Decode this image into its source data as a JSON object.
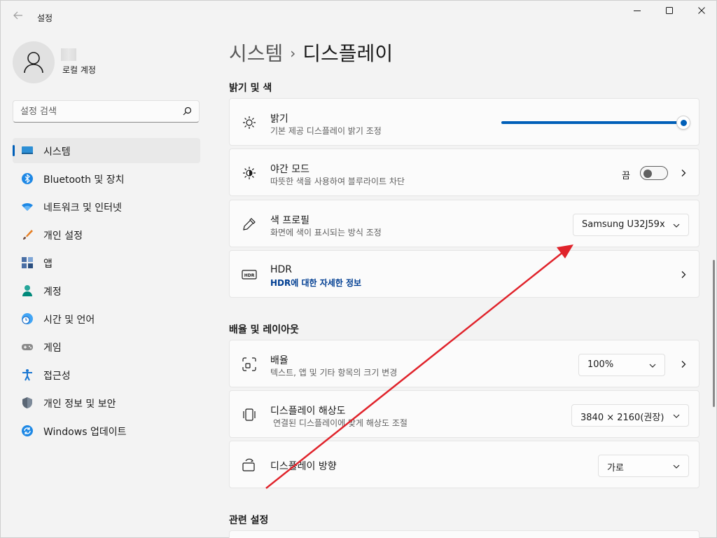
{
  "window": {
    "title": "설정",
    "back_icon": "back-arrow-icon"
  },
  "profile": {
    "account_type": "로컬 계정"
  },
  "search": {
    "placeholder": "설정 검색"
  },
  "nav": [
    {
      "label": "시스템",
      "icon": "monitor-icon",
      "active": true
    },
    {
      "label": "Bluetooth 및 장치",
      "icon": "bluetooth-icon"
    },
    {
      "label": "네트워크 및 인터넷",
      "icon": "wifi-icon"
    },
    {
      "label": "개인 설정",
      "icon": "brush-icon"
    },
    {
      "label": "앱",
      "icon": "apps-icon"
    },
    {
      "label": "계정",
      "icon": "person-icon"
    },
    {
      "label": "시간 및 언어",
      "icon": "clock-globe-icon"
    },
    {
      "label": "게임",
      "icon": "gamepad-icon"
    },
    {
      "label": "접근성",
      "icon": "accessibility-icon"
    },
    {
      "label": "개인 정보 및 보안",
      "icon": "shield-icon"
    },
    {
      "label": "Windows 업데이트",
      "icon": "update-icon"
    }
  ],
  "breadcrumb": {
    "parent": "시스템",
    "separator": "›",
    "current": "디스플레이"
  },
  "sections": {
    "brightness_color": "밝기 및 색",
    "scale_layout": "배율 및 레이아웃",
    "related": "관련 설정"
  },
  "brightness": {
    "title": "밝기",
    "subtitle": "기본 제공 디스플레이 밝기 조정",
    "value_fraction": 1.0
  },
  "night_light": {
    "title": "야간 모드",
    "subtitle": "따뜻한 색을 사용하여 블루라이트 차단",
    "state": "끔"
  },
  "color_profile": {
    "title": "색 프로필",
    "subtitle": "화면에 색이 표시되는 방식 조정",
    "value": "Samsung U32J59x"
  },
  "hdr": {
    "title": "HDR",
    "link": "HDR에 대한 자세한 정보"
  },
  "scale": {
    "title": "배율",
    "subtitle": "텍스트, 앱 및 기타 항목의 크기 변경",
    "value": "100%"
  },
  "resolution": {
    "title": "디스플레이 해상도",
    "subtitle": "연결된 디스플레이에 맞게 해상도 조절",
    "value": "3840 × 2160(권장)"
  },
  "orientation": {
    "title": "디스플레이 방향",
    "value": "가로"
  },
  "colors": {
    "accent": "#005fb8",
    "annotation_arrow": "#e0232b"
  }
}
